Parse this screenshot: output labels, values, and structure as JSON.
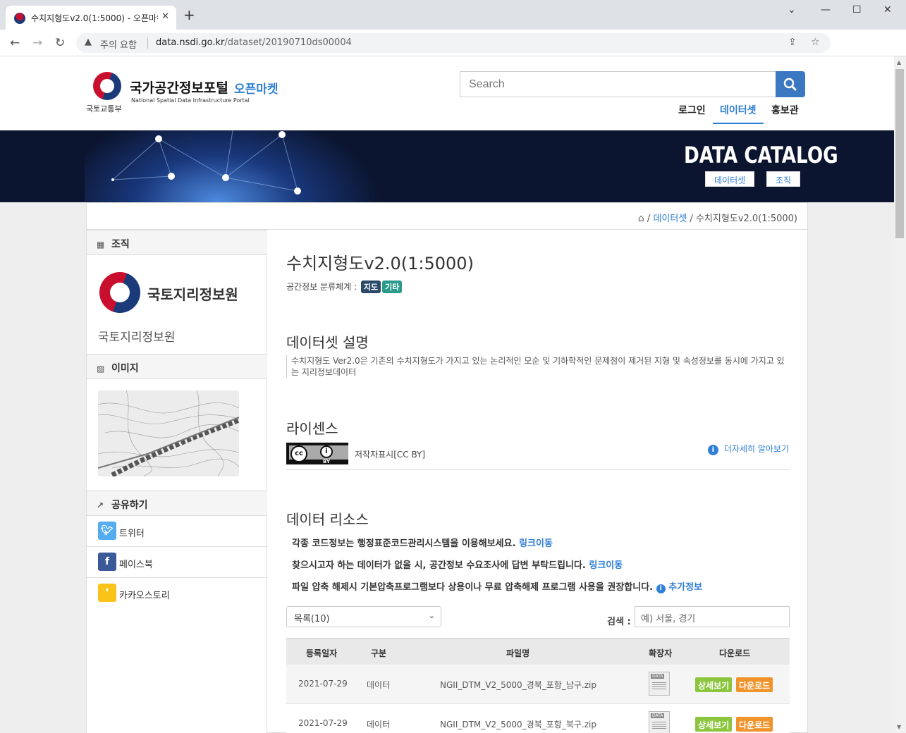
{
  "browser": {
    "tab_title": "수치지형도v2.0(1:5000) - 오픈마켓",
    "tab_close": "✕",
    "new_tab": "+",
    "security_label": "주의 요함",
    "url_host": "data.nsdi.go.kr",
    "url_path": "/dataset/20190710ds00004"
  },
  "header": {
    "ministry": "국토교통부",
    "portal_name": "국가공간정보포털",
    "open_market": "오픈마켓",
    "portal_sub": "National Spatial Data Infrastructure Portal",
    "search_placeholder": "Search",
    "nav": [
      {
        "label": "로그인"
      },
      {
        "label": "데이터셋",
        "active": true
      },
      {
        "label": "홍보관"
      }
    ]
  },
  "banner": {
    "title": "DATA CATALOG",
    "buttons": [
      "데이터셋",
      "조직"
    ]
  },
  "breadcrumb": {
    "items": [
      "데이터셋",
      "수치지형도v2.0(1:5000)"
    ]
  },
  "sidebar": {
    "org_heading": "조직",
    "org_logo_text": "국토지리정보원",
    "org_name": "국토지리정보원",
    "image_heading": "이미지",
    "share_heading": "공유하기",
    "share": [
      {
        "label": "트위터",
        "color": "#55acee",
        "icon": "twitter-icon"
      },
      {
        "label": "페이스북",
        "color": "#3b5998",
        "icon": "facebook-icon"
      },
      {
        "label": "카카오스토리",
        "color": "#f9c31a",
        "icon": "kakaostory-icon"
      }
    ]
  },
  "dataset": {
    "title": "수치지형도v2.0(1:5000)",
    "classification_label": "공간정보 분류체계 :",
    "tags": [
      {
        "label": "지도",
        "color": "#2b4a6a"
      },
      {
        "label": "기타",
        "color": "#2a9a8a"
      }
    ],
    "desc_heading": "데이터셋 설명",
    "description": "수치지형도 Ver2.0은 기존의 수치지형도가 가지고 있는 논리적인 모순 및 기하학적인 문제점이 제거된 지형 및 속성정보를 동시에 가지고 있는 지리정보데이터",
    "license_heading": "라이센스",
    "license_text": "저작자표시[CC BY]",
    "license_more": "더자세히 알아보기",
    "cc_label": "cc",
    "cc_by": "BY",
    "resource_heading": "데이터 리소스",
    "notes": [
      {
        "text": "각종 코드정보는 행정표준코드관리시스템을 이용해보세요.",
        "link": "링크이동"
      },
      {
        "text": "찾으시고자 하는 데이터가 없을 시, 공간정보 수요조사에 답변 부탁드립니다.",
        "link": "링크이동"
      },
      {
        "text": "파일 압축 해제시 기본압축프로그램보다 상용이나 무료 압축해제 프로그램 사용을 권장합니다.",
        "link": "추가정보"
      }
    ],
    "list_select": "목록(10)",
    "search_label": "검색 :",
    "search_placeholder": "예) 서울, 경기",
    "table": {
      "headers": [
        "등록일자",
        "구분",
        "파일명",
        "확장자",
        "다운로드"
      ],
      "rows": [
        {
          "date": "2021-07-29",
          "type": "데이터",
          "file": "NGII_DTM_V2_5000_경북_포항_남구.zip"
        },
        {
          "date": "2021-07-29",
          "type": "데이터",
          "file": "NGII_DTM_V2_5000_경북_포항_북구.zip"
        }
      ],
      "detail_label": "상세보기",
      "download_label": "다운로드"
    }
  }
}
